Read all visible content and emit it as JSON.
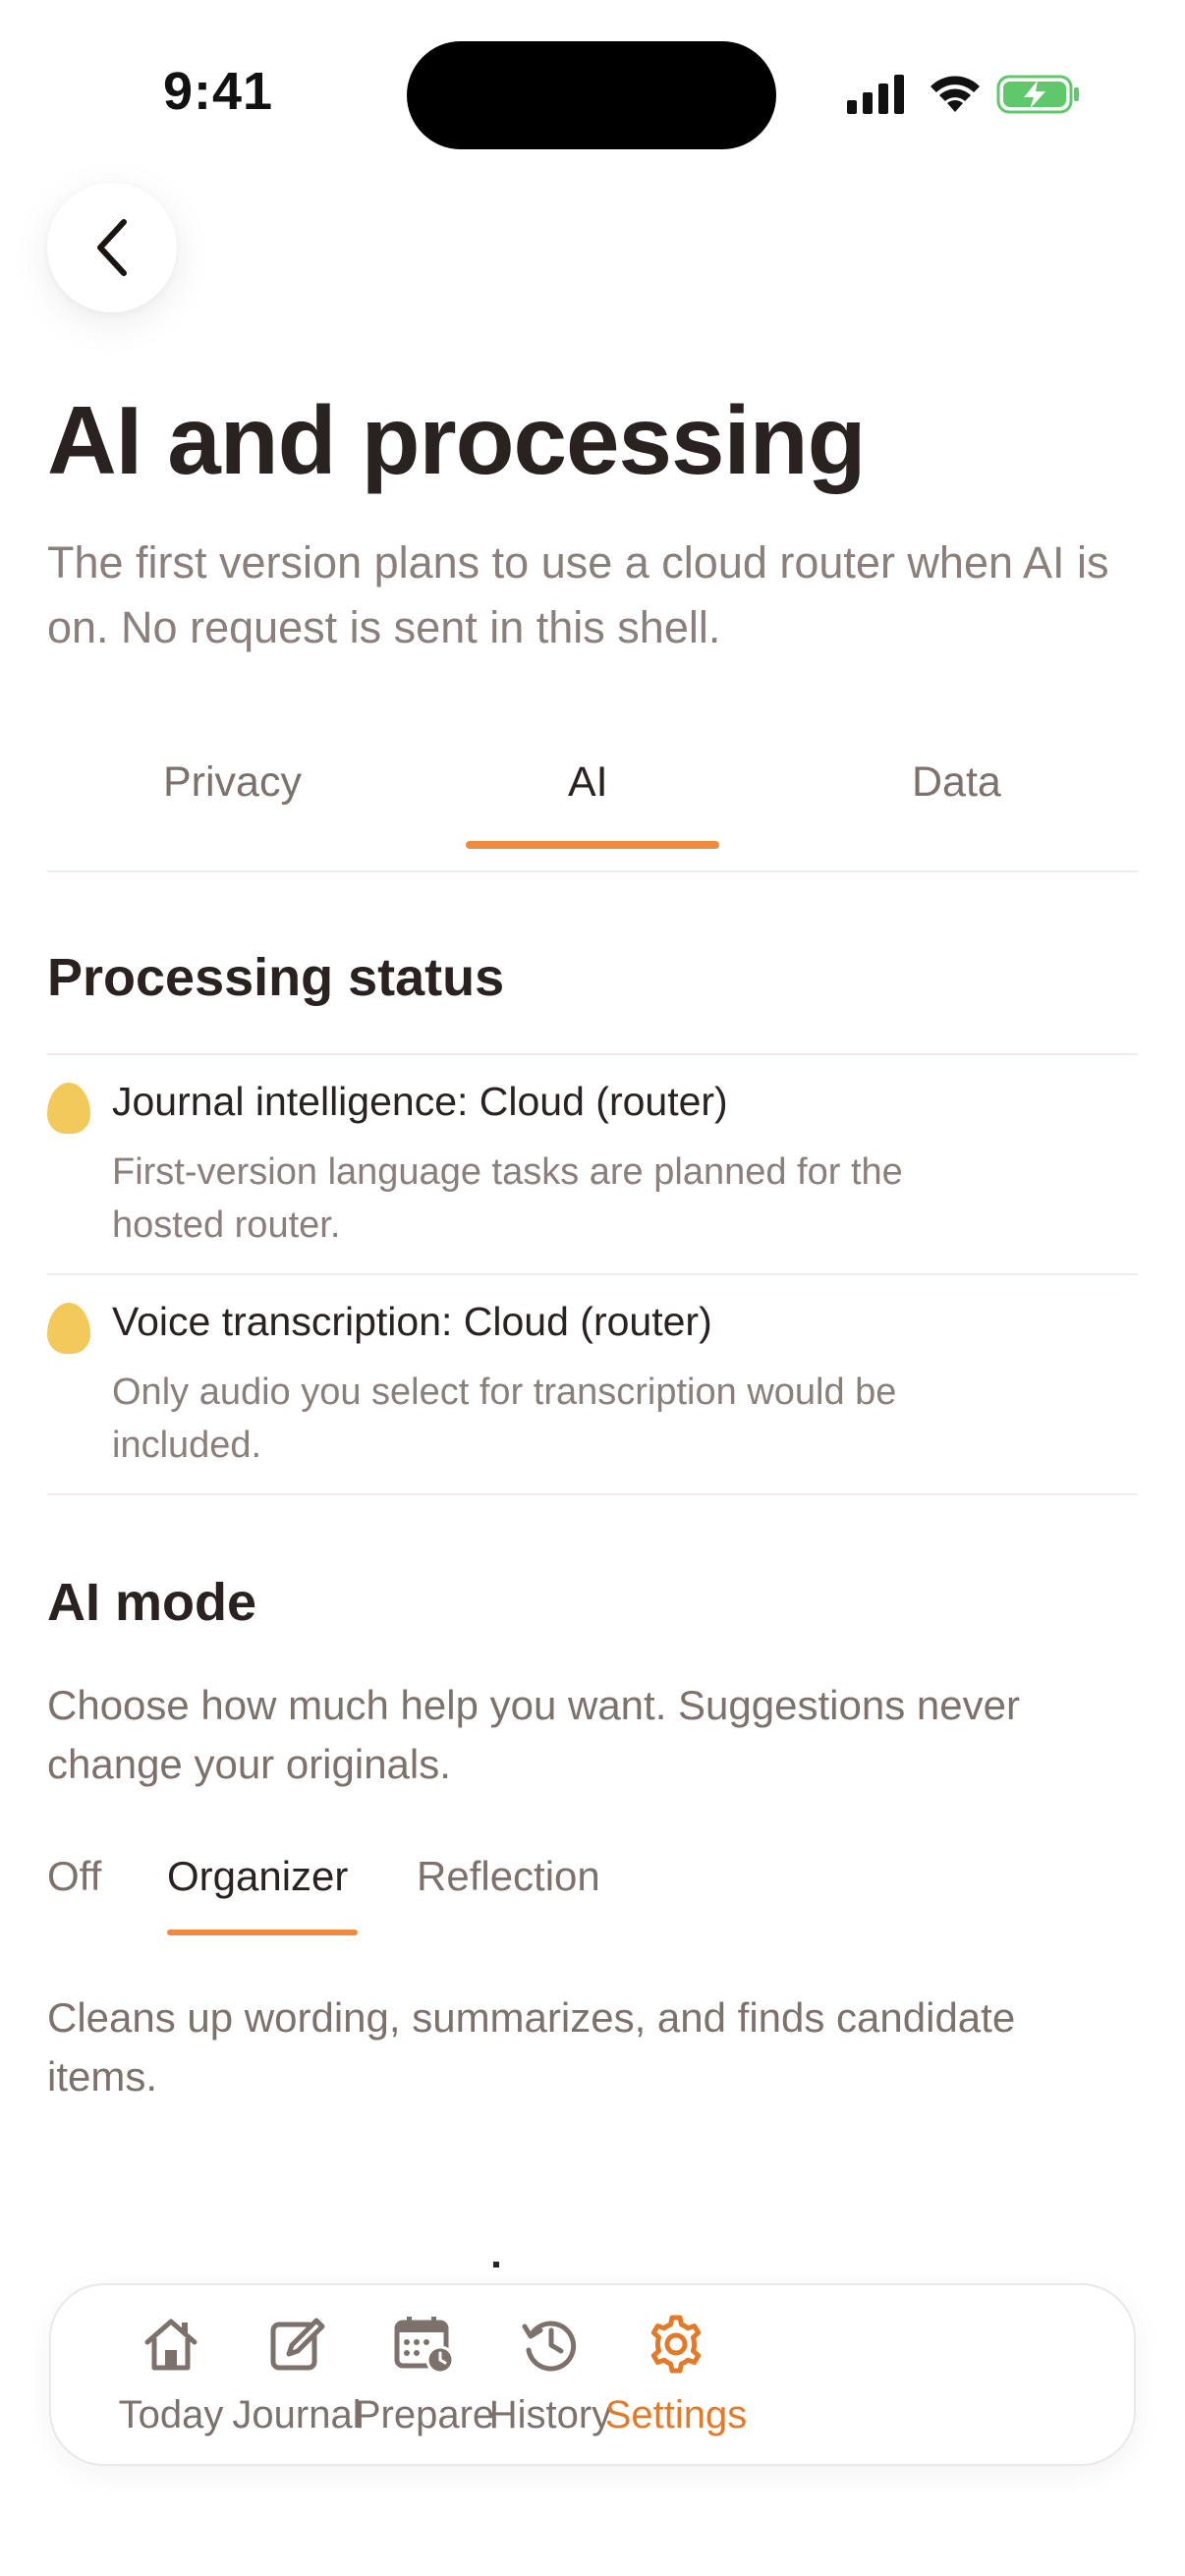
{
  "status_bar": {
    "time": "9:41"
  },
  "header": {
    "title": "AI and processing",
    "subtitle": "The first version plans to use a cloud router when AI is on. No request is sent in this shell."
  },
  "tabs": [
    {
      "label": "Privacy"
    },
    {
      "label": "AI",
      "active": true
    },
    {
      "label": "Data"
    }
  ],
  "processing": {
    "title": "Processing status",
    "items": [
      {
        "title": "Journal intelligence: Cloud (router)",
        "description": "First-version language tasks are planned for the hosted router."
      },
      {
        "title": "Voice transcription: Cloud (router)",
        "description": "Only audio you select for transcription would be included."
      }
    ]
  },
  "ai_mode": {
    "title": "AI mode",
    "description": "Choose how much help you want. Suggestions never change your originals.",
    "options": [
      {
        "label": "Off"
      },
      {
        "label": "Organizer",
        "active": true
      },
      {
        "label": "Reflection"
      }
    ],
    "selected_explanation": "Cleans up wording, summarizes, and finds candidate items."
  },
  "bottom_nav": {
    "items": [
      {
        "label": "Today",
        "icon": "home-icon"
      },
      {
        "label": "Journal",
        "icon": "compose-icon"
      },
      {
        "label": "Prepare",
        "icon": "calendar-clock-icon"
      },
      {
        "label": "History",
        "icon": "history-icon"
      },
      {
        "label": "Settings",
        "icon": "gear-icon",
        "active": true
      }
    ]
  },
  "colors": {
    "accent": "#ef8a3e",
    "status_dot": "#f4c95c",
    "text_primary": "#2a2220",
    "text_secondary": "#8a7f7a"
  }
}
